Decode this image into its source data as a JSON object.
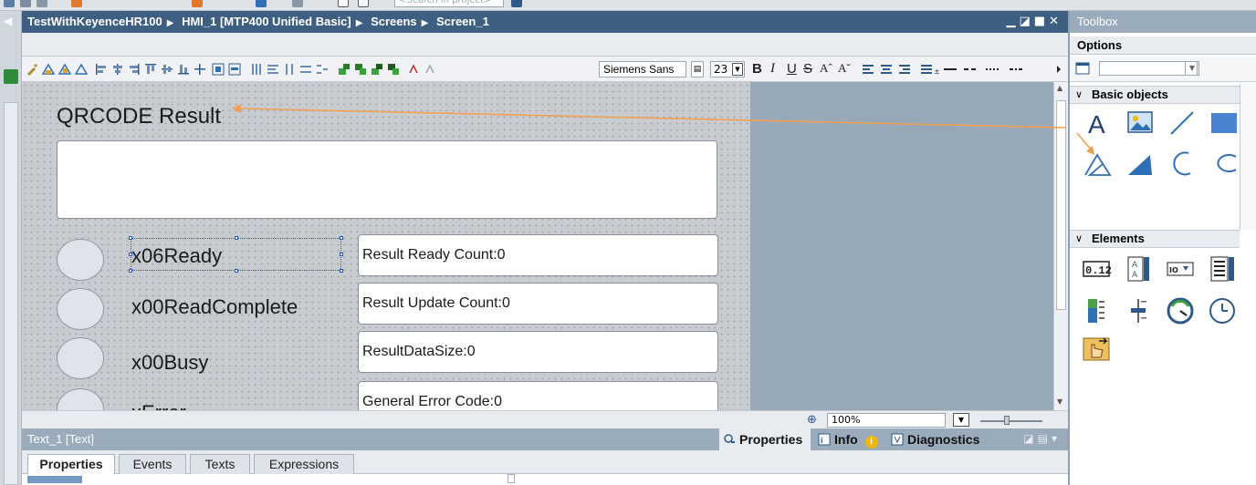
{
  "topbar": {
    "search_placeholder": "<Search in project>"
  },
  "editor": {
    "crumbs": [
      "TestWithKeyenceHR100",
      "HMI_1 [MTP400 Unified Basic]",
      "Screens",
      "Screen_1"
    ],
    "font_name": "Siemens Sans",
    "font_size": "23",
    "zoom": "100%"
  },
  "screen": {
    "title": "QRCODE Result",
    "bits": [
      {
        "label": "x06Ready"
      },
      {
        "label": "x00ReadComplete"
      },
      {
        "label": "x00Busy"
      },
      {
        "label": "xError"
      }
    ],
    "counts": [
      "Result Ready Count:0",
      "Result Update Count:0",
      "ResultDataSize:0",
      "General Error Code:0"
    ]
  },
  "properties": {
    "title": "Text_1 [Text]",
    "inspector_tabs": [
      "Properties",
      "Info",
      "Diagnostics"
    ],
    "sub_tabs": [
      "Properties",
      "Events",
      "Texts",
      "Expressions"
    ]
  },
  "toolbox": {
    "title": "Toolbox",
    "options_label": "Options",
    "sections": [
      "Basic objects",
      "Elements"
    ],
    "basic_objects": [
      "text-tool-icon",
      "graphic-view-icon",
      "line-tool-icon",
      "rectangle-tool-icon",
      "polyline-tool-icon",
      "polygon-tool-icon",
      "circle-segment-icon",
      "arc-tool-icon"
    ],
    "elements": [
      "io-field-icon",
      "symbolic-io-field-icon",
      "switch-icon",
      "list-box-icon",
      "bar-icon",
      "slider-icon",
      "gauge-icon",
      "clock-icon",
      "button-icon"
    ]
  },
  "colors": {
    "title_bar": "#3f5f82",
    "panel_header": "#9aabbb",
    "annotation_arrow": "#f0a050"
  }
}
